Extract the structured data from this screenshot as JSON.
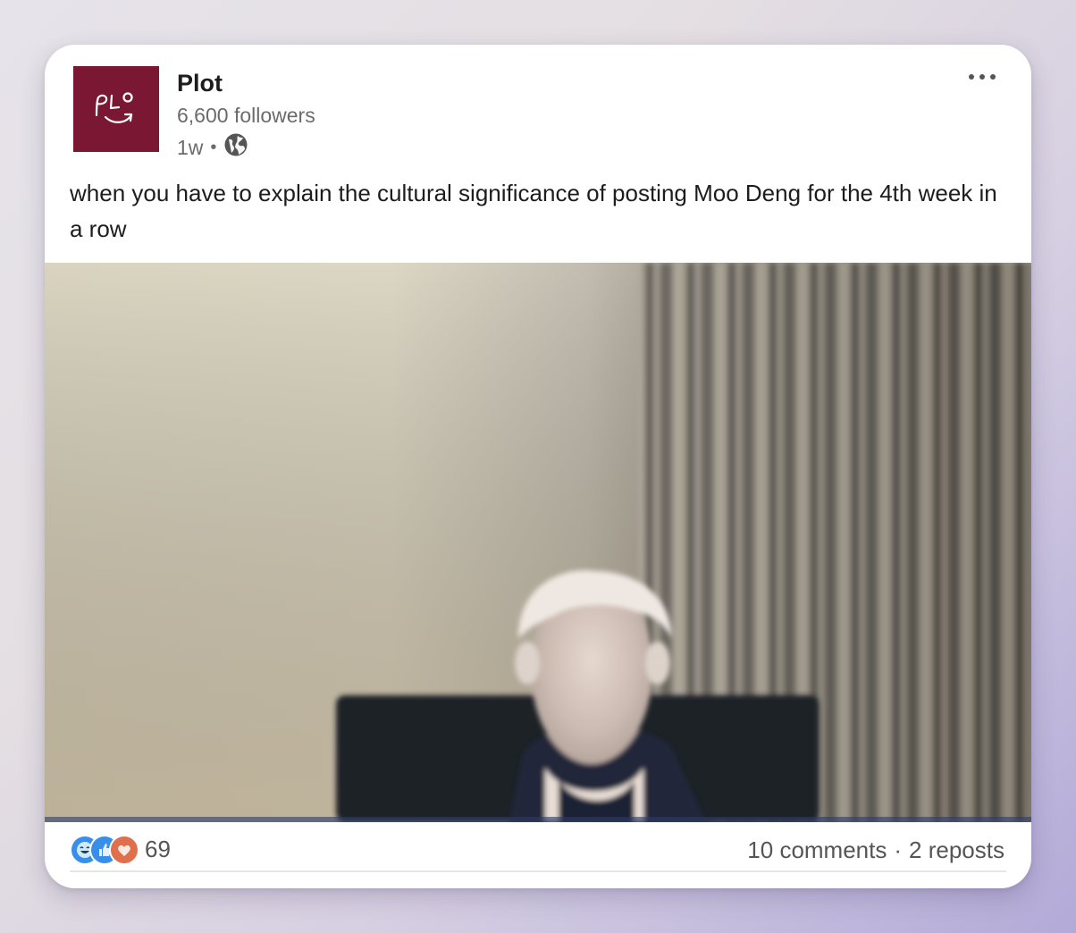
{
  "post": {
    "author": {
      "name": "Plot",
      "followers": "6,600 followers",
      "time": "1w",
      "visibility_icon": "globe-icon",
      "logo_color": "#7a1732",
      "logo_text": "PLO"
    },
    "menu_icon": "more-options-icon",
    "text": "when you have to explain the cultural significance of posting Moo Deng for the 4th week in a row",
    "media": {
      "type": "image"
    },
    "reactions": {
      "icons": [
        "laugh-reaction-icon",
        "like-reaction-icon",
        "love-reaction-icon"
      ],
      "count": "69"
    },
    "stats": {
      "comments": "10 comments",
      "separator": "·",
      "reposts": "2 reposts"
    }
  }
}
